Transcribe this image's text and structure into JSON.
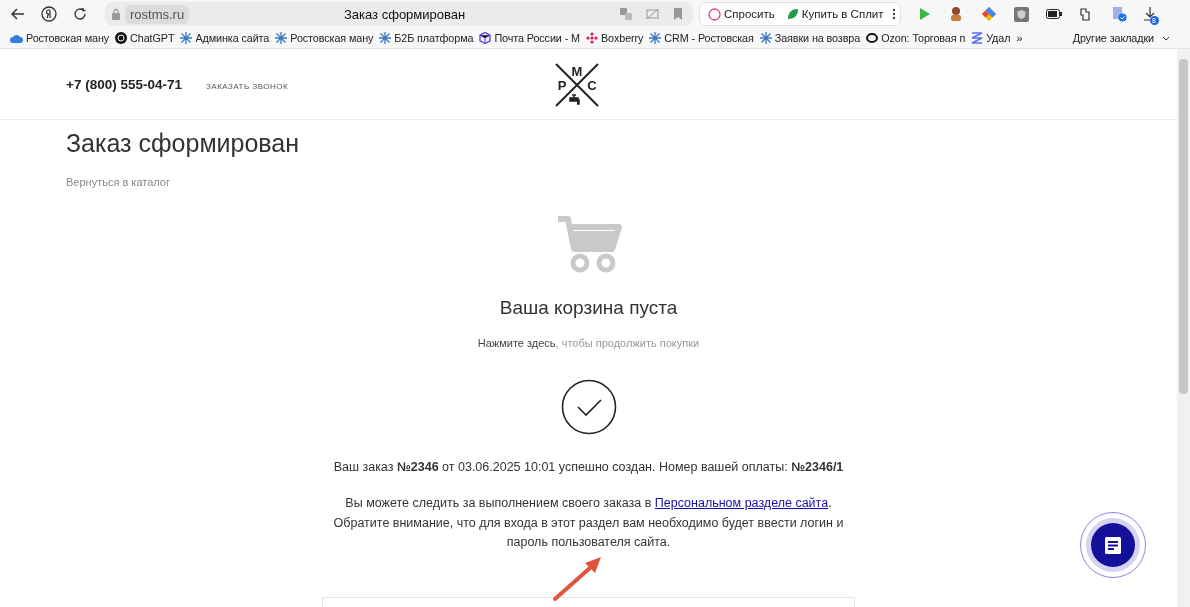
{
  "browser": {
    "url": "rostms.ru",
    "tab_title": "Заказ сформирован",
    "ask": "Спросить",
    "split": "Купить в Сплит",
    "downloads": "8"
  },
  "bookmarks": [
    {
      "label": "Ростовская ману",
      "kind": "cloud"
    },
    {
      "label": "ChatGPT",
      "kind": "knot"
    },
    {
      "label": "Админка сайта",
      "kind": "flake"
    },
    {
      "label": "Ростовская ману",
      "kind": "flake"
    },
    {
      "label": "Б2Б платформа",
      "kind": "flake"
    },
    {
      "label": "Почта России - М",
      "kind": "cube"
    },
    {
      "label": "Boxberry",
      "kind": "dots"
    },
    {
      "label": "CRM - Ростовская",
      "kind": "flake"
    },
    {
      "label": "Заявки на возвра",
      "kind": "flake"
    },
    {
      "label": "Ozon: Торговая п",
      "kind": "ring"
    },
    {
      "label": "Удал",
      "kind": "zigzag"
    }
  ],
  "bookmarks_more": "»",
  "other_bookmarks": "Другие закладки",
  "header": {
    "phone": "+7 (800) 555-04-71",
    "callback": "ЗАКАЗАТЬ ЗВОНОК",
    "logo_letters": [
      "М",
      "Р",
      "С"
    ]
  },
  "page": {
    "title": "Заказ сформирован",
    "back_link": "Вернуться в каталог",
    "cart_title": "Ваша корзина пуста",
    "hint_link": "Нажмите здесь",
    "hint_rest": ", чтобы продолжить покупки",
    "order_message": "Ваш заказ **№2346** от 03.06.2025 10:01 успешно создан. Номер вашей оплаты: **№2346/1**",
    "track_before": "Вы можете следить за выполнением своего заказа в ",
    "track_link": "Персональном разделе сайта",
    "track_after": ". Обратите внимание, что для входа в этот раздел вам необходимо будет ввести логин и пароль пользователя сайта."
  }
}
